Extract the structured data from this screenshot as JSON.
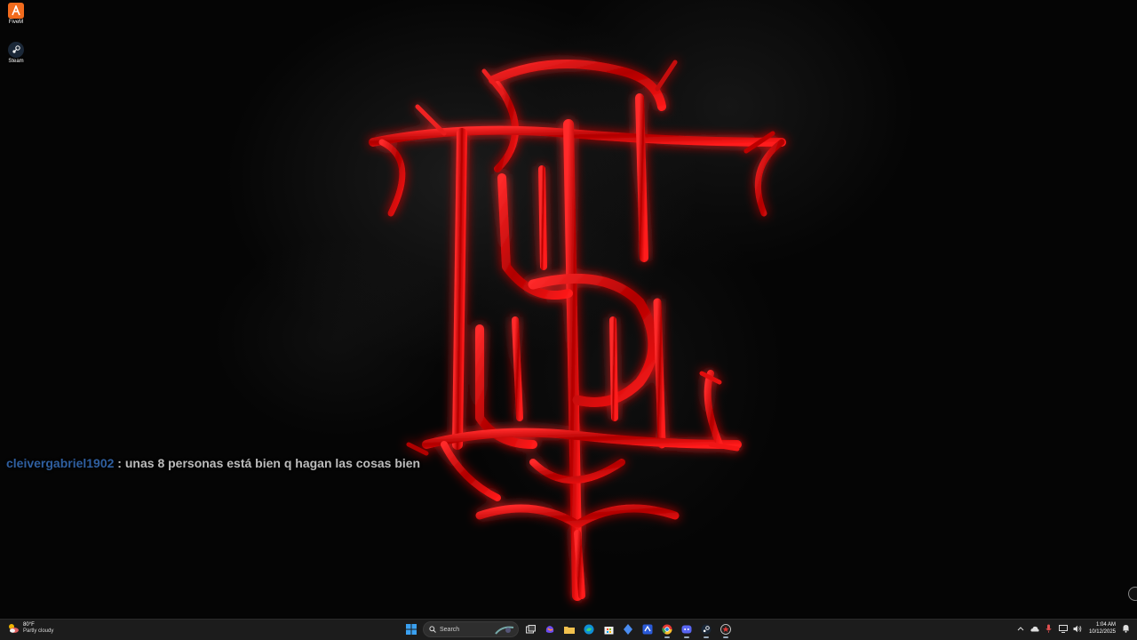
{
  "desktop": {
    "icons": [
      {
        "label": "FiveM",
        "icon": "fivem-icon"
      },
      {
        "label": "Steam",
        "icon": "steam-icon"
      }
    ]
  },
  "chat": {
    "username": "cleivergabriel1902",
    "separator": " : ",
    "message": "unas 8 personas está bien q hagan las cosas bien"
  },
  "taskbar": {
    "weather": {
      "temp": "80°F",
      "condition": "Partly cloudy"
    },
    "search_label": "Search",
    "apps": [
      "start-icon",
      "search-icon",
      "task-view-icon",
      "copilot-icon",
      "file-explorer-icon",
      "edge-icon",
      "store-icon",
      "vpn-icon",
      "app-icon",
      "chrome-icon",
      "discord-icon",
      "steam-icon",
      "rockstar-icon"
    ],
    "clock": {
      "time": "1:04 AM",
      "date": "10/12/2025"
    }
  },
  "colors": {
    "accent_red": "#d10000",
    "chat_user": "#2f5fa0",
    "chat_text": "#bcbcbc",
    "taskbar_bg": "#1c1c1c"
  }
}
